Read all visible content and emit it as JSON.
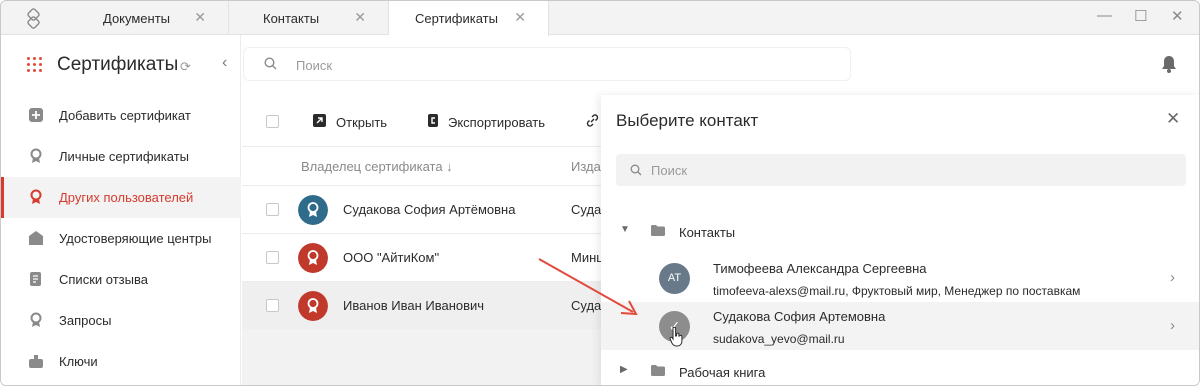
{
  "titlebar": {
    "tabs": [
      {
        "label": "Документы"
      },
      {
        "label": "Контакты"
      },
      {
        "label": "Сертификаты"
      }
    ],
    "close_glyph": "✕",
    "controls": {
      "minimize": "—",
      "maximize": "☐",
      "close": "✕"
    }
  },
  "sidebar": {
    "title": "Сертификаты",
    "items": [
      {
        "label": "Добавить сертификат",
        "icon": "add-icon"
      },
      {
        "label": "Личные сертификаты",
        "icon": "badge-icon"
      },
      {
        "label": "Других пользователей",
        "icon": "badge-icon",
        "active": true
      },
      {
        "label": "Удостоверяющие центры",
        "icon": "bank-icon"
      },
      {
        "label": "Списки отзыва",
        "icon": "list-icon"
      },
      {
        "label": "Запросы",
        "icon": "badge-icon"
      },
      {
        "label": "Ключи",
        "icon": "key-icon"
      }
    ]
  },
  "search": {
    "placeholder": "Поиск"
  },
  "toolbar": {
    "open_label": "Открыть",
    "export_label": "Экспортировать"
  },
  "table": {
    "columns": {
      "owner": "Владелец сертификата",
      "issuer": "Изда"
    },
    "rows": [
      {
        "owner": "Судакова София Артёмовна",
        "issuer": "Суда",
        "avatar_color": "#2f6b8a"
      },
      {
        "owner": "ООО \"АйтиКом\"",
        "issuer": "Минц",
        "avatar_color": "#c0392b"
      },
      {
        "owner": "Иванов Иван Иванович",
        "issuer": "Суда",
        "avatar_color": "#c0392b"
      }
    ]
  },
  "panel": {
    "title": "Выберите контакт",
    "search_placeholder": "Поиск",
    "groups": [
      {
        "label": "Контакты",
        "expanded": true
      },
      {
        "label": "Рабочая книга",
        "expanded": false
      }
    ],
    "contacts": [
      {
        "initials": "АТ",
        "name": "Тимофеева Александра Сергеевна",
        "sub": "timofeeva-alexs@mail.ru, Фруктовый мир, Менеджер по поставкам"
      },
      {
        "initials": "✓",
        "name": "Судакова София Артемовна",
        "sub": "sudakova_yevo@mail.ru"
      }
    ]
  },
  "colors": {
    "accent": "#d63b2e",
    "avatar_blue": "#2f6b8a",
    "avatar_red": "#c0392b",
    "contact_avatar": "#687a8a"
  }
}
